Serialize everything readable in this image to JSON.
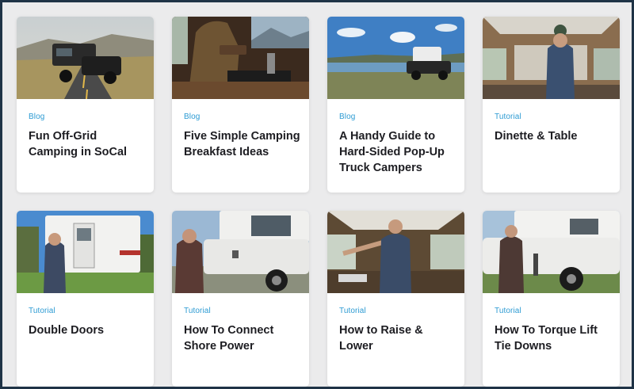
{
  "cards": [
    {
      "category": "Blog",
      "title": "Fun Off-Grid Camping in SoCal",
      "image": "truck-camper-on-road-photo"
    },
    {
      "category": "Blog",
      "title": "Five Simple Camping Breakfast Ideas",
      "image": "cooking-in-camper-photo"
    },
    {
      "category": "Blog",
      "title": "A Handy Guide to Hard-Sided Pop-Up Truck Campers",
      "image": "camper-by-lake-photo"
    },
    {
      "category": "Tutorial",
      "title": "Dinette & Table",
      "image": "camper-interior-photo"
    },
    {
      "category": "Tutorial",
      "title": "Double Doors",
      "image": "camper-rear-doors-photo"
    },
    {
      "category": "Tutorial",
      "title": "How To Connect Shore Power",
      "image": "shore-power-photo"
    },
    {
      "category": "Tutorial",
      "title": "How to Raise & Lower",
      "image": "raise-lower-photo"
    },
    {
      "category": "Tutorial",
      "title": "How To Torque Lift Tie Downs",
      "image": "tie-downs-photo"
    }
  ],
  "colors": {
    "category": "#2d9bd3",
    "title": "#1d1d22",
    "background": "#ebebec",
    "border": "#1f3346"
  }
}
